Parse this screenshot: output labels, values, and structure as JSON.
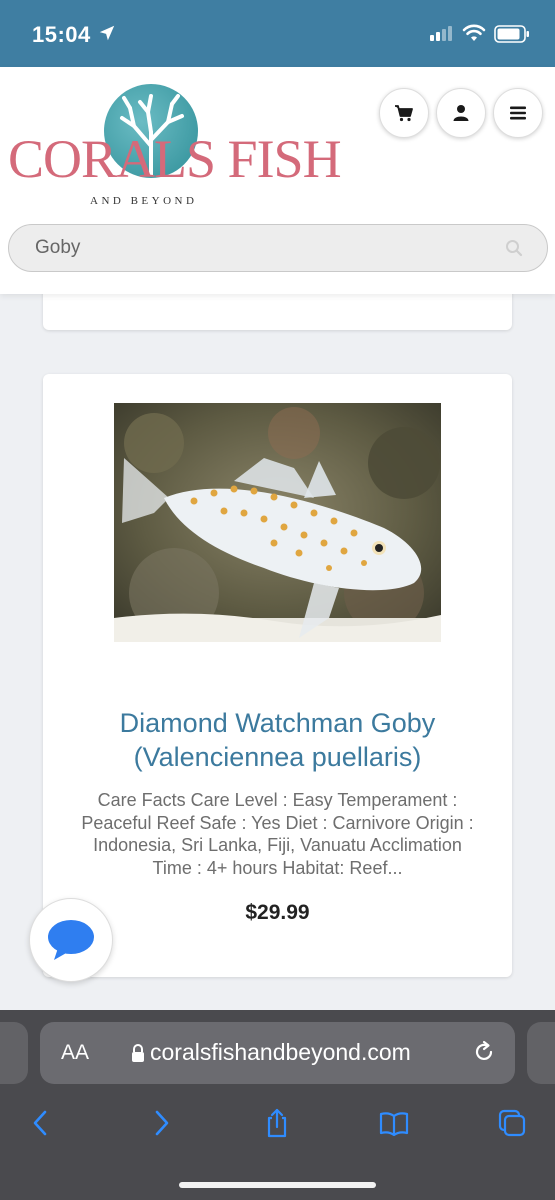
{
  "status_bar": {
    "time": "15:04",
    "icons": [
      "location-arrow-icon",
      "cellular-signal-icon",
      "wifi-icon",
      "battery-icon"
    ]
  },
  "header": {
    "logo": {
      "name": "CORALS FISH",
      "tagline": "AND BEYOND"
    },
    "buttons": [
      "cart-icon",
      "user-icon",
      "menu-icon"
    ]
  },
  "search": {
    "value": "Goby",
    "placeholder": "Search"
  },
  "product": {
    "title": "Diamond Watchman Goby (Valenciennea puellaris)",
    "description": "Care Facts Care Level : Easy Temperament : Peaceful Reef Safe : Yes Diet : Carnivore Origin : Indonesia, Sri Lanka, Fiji, Vanuatu Acclimation Time : 4+ hours Habitat: Reef...",
    "price": "$29.99"
  },
  "chat": {
    "icon": "chat-bubble-icon"
  },
  "browser": {
    "text_size_label": "AA",
    "url": "coralsfishandbeyond.com",
    "toolbar": [
      "back-icon",
      "forward-icon",
      "share-icon",
      "bookmarks-icon",
      "tabs-icon"
    ]
  },
  "colors": {
    "status_bar": "#3f7ea2",
    "title_blue": "#3c7a9e",
    "logo_pink": "#d46a7a",
    "logo_teal": "#2f8f98",
    "chat_blue": "#2f7ef0",
    "toolbar_blue": "#2f8cff",
    "safari_bar": "#4a4a4e"
  }
}
